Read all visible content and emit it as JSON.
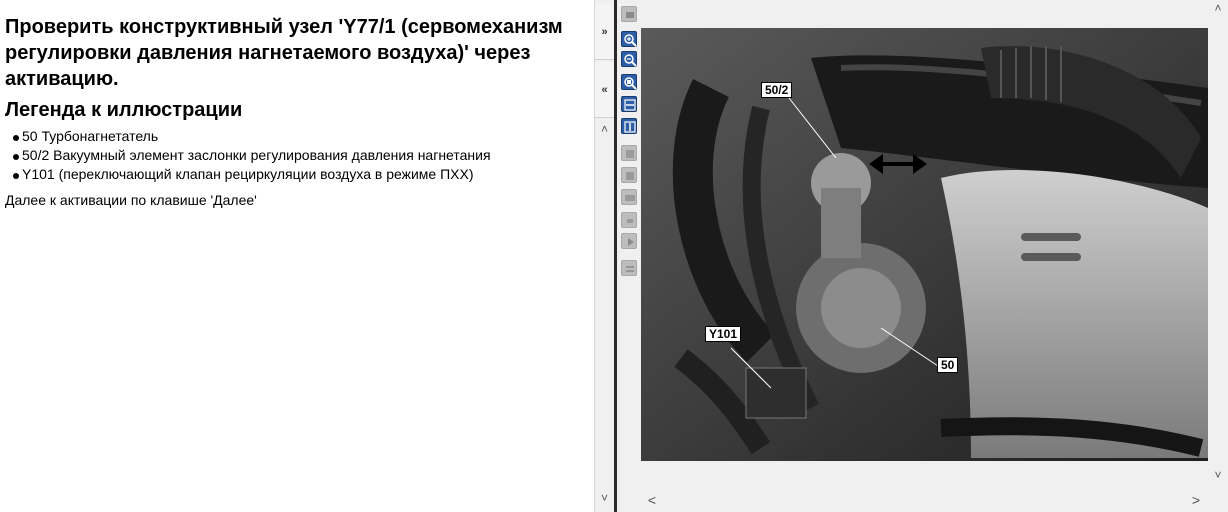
{
  "document": {
    "title": "Проверить конструктивный узел 'Y77/1 (сервомеханизм регулировки давления нагнетаемого воздуха)' через активацию.",
    "legend_heading": "Легенда к иллюстрации",
    "legend_items": [
      "50 Турбонагнетатель",
      "50/2 Вакуумный элемент заслонки регулирования давления нагнетания",
      "Y101 (переключающий клапан рециркуляции воздуха в режиме ПХХ)"
    ],
    "next_hint": "Далее к активации по клавише 'Далее'"
  },
  "pane_controls": {
    "collapse_right": "»",
    "collapse_left": "«",
    "scroll_up": "˄",
    "scroll_down": "˅"
  },
  "image_scroll": {
    "left": "<",
    "right": ">"
  },
  "figure": {
    "callouts": [
      "50/2",
      "Y101",
      "50"
    ]
  },
  "toolbar": {
    "tools": [
      {
        "icon": "image-settings-icon",
        "state": "disabled"
      },
      {
        "icon": "zoom-in-icon",
        "state": "active"
      },
      {
        "icon": "zoom-out-icon",
        "state": "active"
      },
      {
        "icon": "zoom-reset-icon",
        "state": "active"
      },
      {
        "icon": "fit-width-icon",
        "state": "active"
      },
      {
        "icon": "fit-height-icon",
        "state": "active"
      },
      {
        "icon": "previous-figure-icon",
        "state": "disabled"
      },
      {
        "icon": "rotate-icon",
        "state": "disabled"
      },
      {
        "icon": "print-icon",
        "state": "disabled"
      },
      {
        "icon": "hotspot-icon",
        "state": "disabled"
      },
      {
        "icon": "play-icon",
        "state": "disabled"
      },
      {
        "icon": "list-icon",
        "state": "disabled"
      }
    ]
  },
  "colors": {
    "toolbar_active": "#2e5fa6",
    "toolbar_disabled": "#bdbdbd",
    "splitter": "#2a2a2a"
  }
}
